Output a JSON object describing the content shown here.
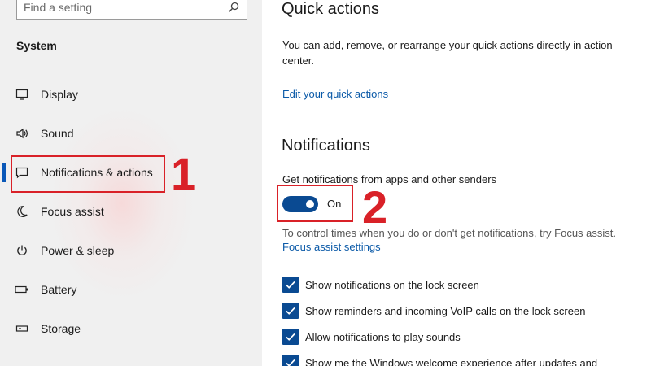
{
  "sidebar": {
    "search_placeholder": "Find a setting",
    "section_title": "System",
    "items": [
      {
        "label": "Display"
      },
      {
        "label": "Sound"
      },
      {
        "label": "Notifications & actions"
      },
      {
        "label": "Focus assist"
      },
      {
        "label": "Power & sleep"
      },
      {
        "label": "Battery"
      },
      {
        "label": "Storage"
      }
    ]
  },
  "annotations": {
    "one": "1",
    "two": "2",
    "color": "#d92128"
  },
  "content": {
    "quick_actions_title": "Quick actions",
    "quick_actions_desc": "You can add, remove, or rearrange your quick actions directly in action center.",
    "edit_quick_actions_link": "Edit your quick actions",
    "notifications_title": "Notifications",
    "get_notifications_label": "Get notifications from apps and other senders",
    "toggle_state": "On",
    "focus_hint": "To control times when you do or don't get notifications, try Focus assist.",
    "focus_assist_link": "Focus assist settings",
    "checkboxes": [
      {
        "label": "Show notifications on the lock screen"
      },
      {
        "label": "Show reminders and incoming VoIP calls on the lock screen"
      },
      {
        "label": "Allow notifications to play sounds"
      },
      {
        "label": "Show me the Windows welcome experience after updates and"
      }
    ]
  },
  "colors": {
    "accent": "#0a4a92",
    "link": "#0b5aa8",
    "active_indicator": "#0a58b8"
  }
}
